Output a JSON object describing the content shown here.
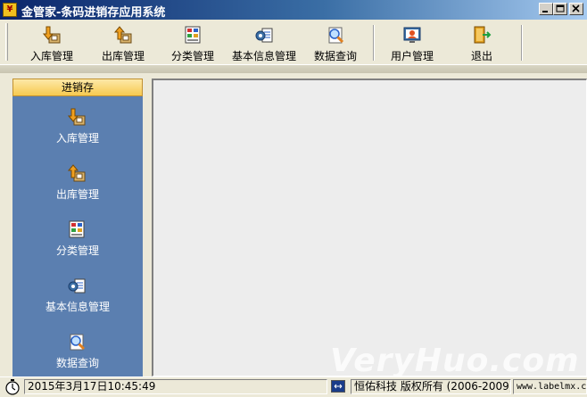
{
  "window": {
    "title": "金管家-条码进销存应用系统"
  },
  "toolbar": {
    "buttons": [
      {
        "label": "入库管理",
        "icon": "stock-in-icon"
      },
      {
        "label": "出库管理",
        "icon": "stock-out-icon"
      },
      {
        "label": "分类管理",
        "icon": "category-icon"
      },
      {
        "label": "基本信息管理",
        "icon": "basic-info-icon"
      },
      {
        "label": "数据查询",
        "icon": "search-icon"
      },
      {
        "label": "用户管理",
        "icon": "user-icon"
      },
      {
        "label": "退出",
        "icon": "exit-icon"
      }
    ]
  },
  "sidebar": {
    "header": "进销存",
    "items": [
      {
        "label": "入库管理",
        "icon": "stock-in-icon"
      },
      {
        "label": "出库管理",
        "icon": "stock-out-icon"
      },
      {
        "label": "分类管理",
        "icon": "category-icon"
      },
      {
        "label": "基本信息管理",
        "icon": "basic-info-icon"
      },
      {
        "label": "数据查询",
        "icon": "search-icon"
      }
    ]
  },
  "status": {
    "datetime": "2015年3月17日10:45:49",
    "company": "恒佑科技  版权所有 (2006-2009)",
    "website": "www.labelmx.c"
  },
  "watermark": "VeryHuo.com",
  "colors": {
    "title_start": "#0a246a",
    "sidebar_bg": "#5b7fb0",
    "sidebar_header": "#f7c94f"
  }
}
